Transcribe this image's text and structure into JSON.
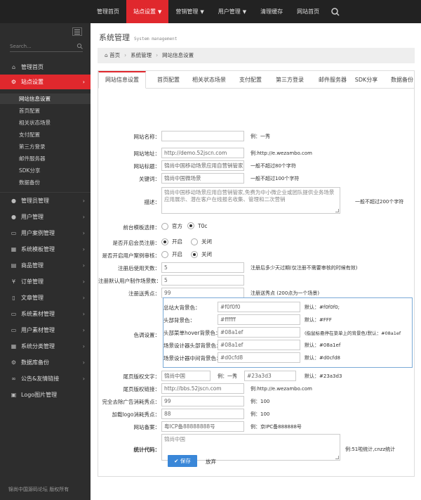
{
  "topnav": {
    "items": [
      "管理首页",
      "站点设置",
      "营销管理",
      "用户管理",
      "清理缓存",
      "网站首页"
    ],
    "active_index": 1
  },
  "sidebar": {
    "search_placeholder": "Search...",
    "items": [
      {
        "label": "管理首页",
        "icon": "home-icon"
      },
      {
        "label": "站点设置",
        "icon": "cogs-icon",
        "active": true
      },
      {
        "label": "管理员管理",
        "icon": "user-icon"
      },
      {
        "label": "用户管理",
        "icon": "user-icon"
      },
      {
        "label": "用户案例管理",
        "icon": "monitor-icon"
      },
      {
        "label": "系统模板管理",
        "icon": "film-icon"
      },
      {
        "label": "商品管理",
        "icon": "list-icon"
      },
      {
        "label": "订单管理",
        "icon": "yen-icon"
      },
      {
        "label": "文章管理",
        "icon": "file-icon"
      },
      {
        "label": "系统素材管理",
        "icon": "monitor-icon"
      },
      {
        "label": "用户素材管理",
        "icon": "monitor-icon"
      },
      {
        "label": "系统分类管理",
        "icon": "grid-icon"
      },
      {
        "label": "数据库备份",
        "icon": "cogs-icon"
      },
      {
        "label": "公告&友情链接",
        "icon": "link-icon"
      },
      {
        "label": "Logo图片管理",
        "icon": "image-icon"
      }
    ],
    "subitems": [
      "网站信息设置",
      "首页配置",
      "相关状态场景",
      "支付配置",
      "第三方登录",
      "邮件服务器",
      "SDK分享",
      "数据备份"
    ],
    "footer": "锦尚中国源码论坛 版权所有"
  },
  "page": {
    "title": "系统管理",
    "title_en": "System management",
    "breadcrumb": [
      "首页",
      "系统管理",
      "网站信息设置"
    ]
  },
  "tabs": [
    "网站信息设置",
    "首页配置",
    "相关状态场景",
    "支付配置",
    "第三方登录",
    "邮件服务器",
    "SDK分享",
    "数据备份"
  ],
  "form": {
    "site_name": {
      "label": "网站名称：",
      "value": "",
      "hint": "例：一秀"
    },
    "site_url": {
      "label": "网站地址：",
      "value": "http://demo.52jscn.com",
      "hint": "例:http://e.wezambo.com"
    },
    "site_title": {
      "label": "网站标题：",
      "value": "锦尚中国移动场景应用自营销管家",
      "hint": "一般不超过80个字符"
    },
    "keywords": {
      "label": "关键词：",
      "value": "锦尚中国微场景",
      "hint": "一般不超过100个字符"
    },
    "description": {
      "label": "描述：",
      "value": "锦尚中国移动场景应用自营销管家,免费为中小微企业或团队提供业务场景应用展示、潜在客户在线报名收集、管理和二次营销",
      "hint": "一般不超过200个字符"
    },
    "template": {
      "label": "前台模板选择：",
      "options": [
        "官方",
        "T0c"
      ],
      "selected": 1
    },
    "member_register": {
      "label": "是否开启会员注册：",
      "options": [
        "开启",
        "关闭"
      ],
      "selected": 0
    },
    "case_review": {
      "label": "是否开启用户案例审核：",
      "options": [
        "开启",
        "关闭"
      ],
      "selected": 1
    },
    "register_days": {
      "label": "注册后使用天数：",
      "value": "5",
      "hint": "注册后多少天过期(仅注册不需要审核的时候有效)"
    },
    "default_scenes": {
      "label": "注册默认用户制作场景数：",
      "value": "5"
    },
    "register_points": {
      "label": "注册送秀点：",
      "value": "99",
      "hint": "注册送秀点 (200点为一个场景)"
    },
    "color": {
      "label": "色调设置：",
      "rows": [
        {
          "label": "总站大背景色：",
          "value": "#f0f0f0",
          "hint": "默认：#f0f0f0;"
        },
        {
          "label": "头部背景色：",
          "value": "#ffffff",
          "hint": "默认：#FFF"
        },
        {
          "label": "头部菜单hover背景色：",
          "value": "#08a1ef",
          "hint": "(指鼠标悬停在菜单上的背景色)默认：#08a1ef"
        },
        {
          "label": "场景设计器头部背景色：",
          "value": "#08a1ef",
          "hint": "默认：#08a1ef"
        },
        {
          "label": "场景设计器中间背景色：",
          "value": "#d0cfd8",
          "hint": "默认：#d0cfd8"
        }
      ]
    },
    "footer_text": {
      "label": "尾页版权文字：",
      "value": "锦尚中国",
      "example_label": "例：一秀",
      "color_value": "#23a3d3",
      "hint": "默认：#23a3d3"
    },
    "footer_link": {
      "label": "尾页版权链接：",
      "value": "http://bbs.52jscn.com",
      "hint": "例:http://e.wezambo.com"
    },
    "remove_ad_points": {
      "label": "完全去除广告消耗秀点：",
      "value": "99",
      "hint": "例：100"
    },
    "logo_points": {
      "label": "加载logo消耗秀点：",
      "value": "88",
      "hint": "例：100"
    },
    "icp": {
      "label": "网站备案：",
      "value": "粤ICP备88888888号",
      "hint": "例：京IPC备888888号"
    },
    "stats_code": {
      "label": "统计代码：",
      "value": "锦尚中国",
      "hint": "例:51啦统计,cnzz统计"
    },
    "save_label": "保存",
    "cancel_label": "放弃"
  }
}
